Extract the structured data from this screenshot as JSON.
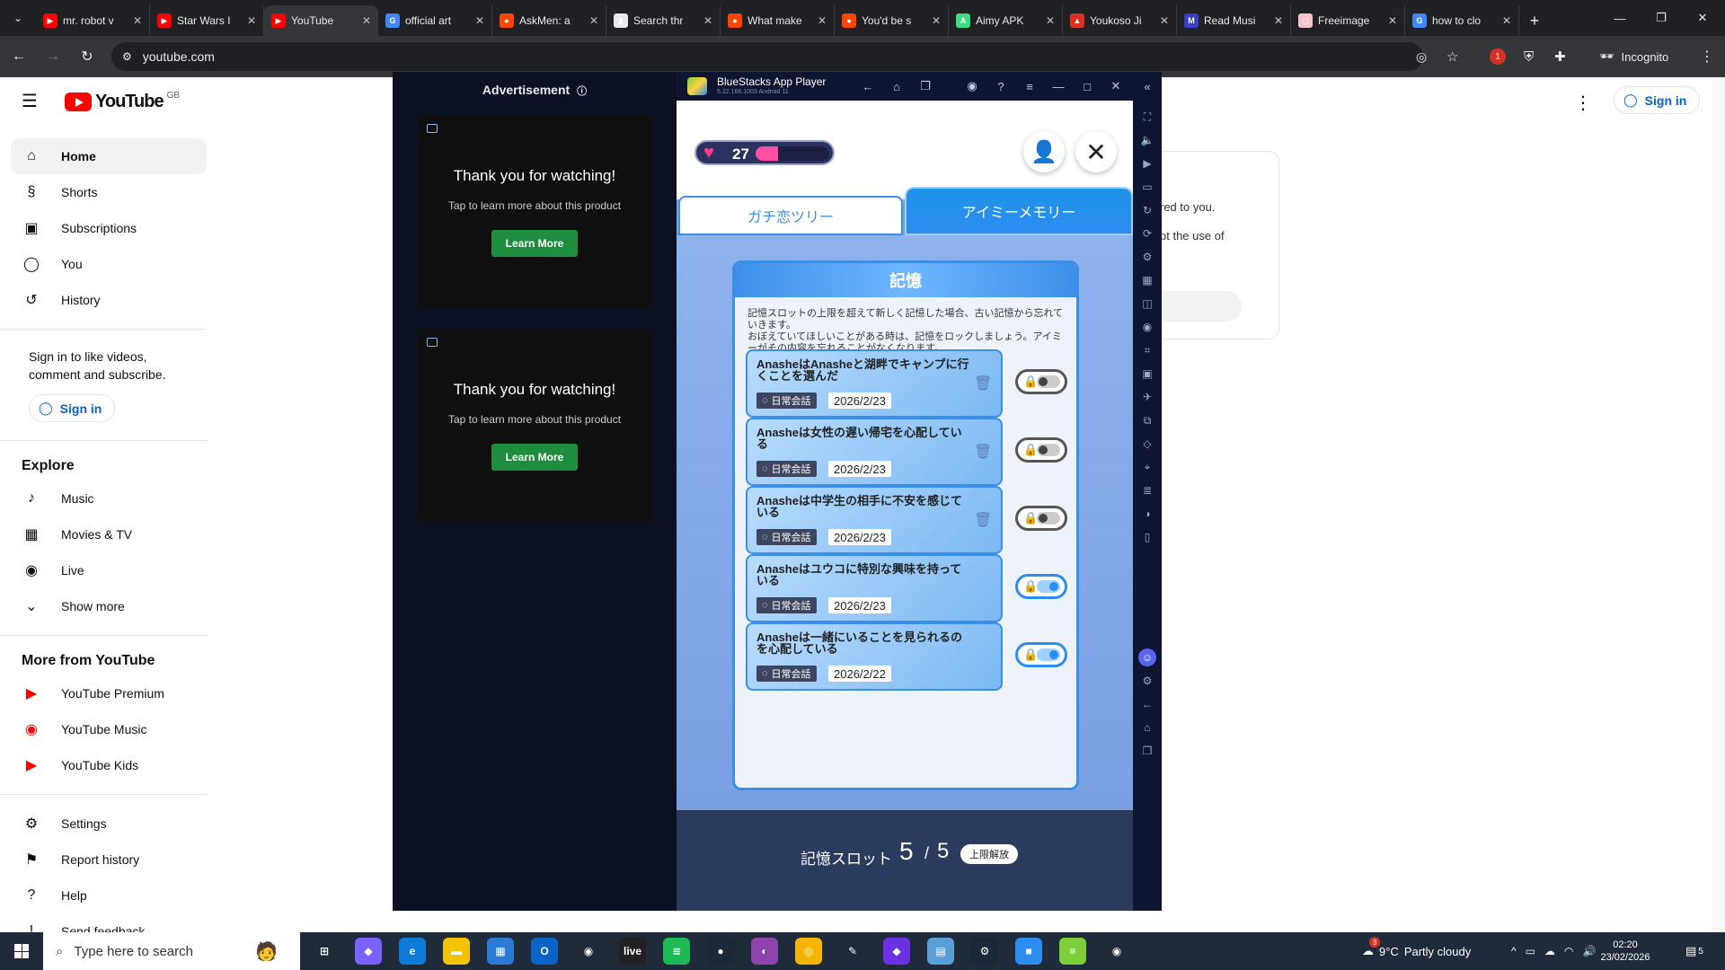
{
  "browser": {
    "tabs": [
      {
        "label": "mr. robot v",
        "icon": "youtube-icon",
        "color": "#ff0000"
      },
      {
        "label": "Star Wars I",
        "icon": "youtube-icon",
        "color": "#ff0000"
      },
      {
        "label": "YouTube",
        "icon": "youtube-icon",
        "color": "#ff0000",
        "active": true
      },
      {
        "label": "official art",
        "icon": "google-icon",
        "color": "#4285f4"
      },
      {
        "label": "AskMen: a",
        "icon": "reddit-icon",
        "color": "#ff4500"
      },
      {
        "label": "Search thr",
        "icon": "document-icon",
        "color": "#e8eaed"
      },
      {
        "label": "What make",
        "icon": "reddit-icon",
        "color": "#ff4500"
      },
      {
        "label": "You'd be s",
        "icon": "reddit-icon",
        "color": "#ff4500"
      },
      {
        "label": "Aimy APK",
        "icon": "apk-icon",
        "color": "#3ddc84"
      },
      {
        "label": "Youkoso Ji",
        "icon": "manga-icon",
        "color": "#d93025"
      },
      {
        "label": "Read Musi",
        "icon": "bookmark-icon",
        "color": "#3c40c6"
      },
      {
        "label": "Freeimage",
        "icon": "image-host-icon",
        "color": "#f8c3c8"
      },
      {
        "label": "how to clo",
        "icon": "google-icon",
        "color": "#4285f4"
      }
    ],
    "url": "youtube.com",
    "incognito_label": "Incognito",
    "extension_badge": "1"
  },
  "youtube": {
    "logo_text": "YouTube",
    "region": "GB",
    "nav_main": [
      {
        "label": "Home",
        "icon": "home-icon",
        "active": true
      },
      {
        "label": "Shorts",
        "icon": "shorts-icon"
      },
      {
        "label": "Subscriptions",
        "icon": "subscriptions-icon"
      },
      {
        "label": "You",
        "icon": "you-icon"
      },
      {
        "label": "History",
        "icon": "history-icon"
      }
    ],
    "signin_prompt": "Sign in to like videos, comment and subscribe.",
    "signin_label": "Sign in",
    "explore_heading": "Explore",
    "nav_explore": [
      {
        "label": "Music",
        "icon": "music-icon"
      },
      {
        "label": "Movies & TV",
        "icon": "movies-icon"
      },
      {
        "label": "Live",
        "icon": "live-icon"
      },
      {
        "label": "Show more",
        "icon": "chevron-down-icon"
      }
    ],
    "more_heading": "More from YouTube",
    "nav_more": [
      {
        "label": "YouTube Premium",
        "icon": "youtube-premium-icon"
      },
      {
        "label": "YouTube Music",
        "icon": "youtube-music-icon"
      },
      {
        "label": "YouTube Kids",
        "icon": "youtube-kids-icon"
      }
    ],
    "nav_footer": [
      {
        "label": "Settings",
        "icon": "gear-icon"
      },
      {
        "label": "Report history",
        "icon": "flag-icon"
      },
      {
        "label": "Help",
        "icon": "help-icon"
      },
      {
        "label": "Send feedback",
        "icon": "feedback-icon"
      }
    ],
    "top_signin": "Sign in",
    "bg_card_line1": "red to you.",
    "bg_card_line2": "pt the use of"
  },
  "ad": {
    "title": "Advertisement",
    "cards": [
      {
        "heading": "Thank you for watching!",
        "sub": "Tap to learn more about this product",
        "button": "Learn More"
      },
      {
        "heading": "Thank you for watching!",
        "sub": "Tap to learn more about this product",
        "button": "Learn More"
      }
    ]
  },
  "bluestacks": {
    "title": "BlueStacks App Player",
    "version": "5.22.166.1003  Android 11"
  },
  "game": {
    "hearts": "27",
    "heart_fill_fraction": 0.3,
    "tab_left": "ガチ恋ツリー",
    "tab_right": "アイミーメモリー",
    "panel_title": "記憶",
    "panel_desc1": "記憶スロットの上限を超えて新しく記憶した場合、古い記憶から忘れていきます。",
    "panel_desc2": "おぼえていてほしいことがある時は、記憶をロックしましょう。アイミーがその内容を忘れることがなくなります。",
    "memories": [
      {
        "text": "AnasheはAnasheと湖畔でキャンプに行くことを選んだ",
        "tag": "日常会話",
        "date": "2026/2/23",
        "locked": false
      },
      {
        "text": "Anasheは女性の遅い帰宅を心配している",
        "tag": "日常会話",
        "date": "2026/2/23",
        "locked": false
      },
      {
        "text": "Anasheは中学生の相手に不安を感じている",
        "tag": "日常会話",
        "date": "2026/2/23",
        "locked": false
      },
      {
        "text": "Anasheはユウコに特別な興味を持っている",
        "tag": "日常会話",
        "date": "2026/2/23",
        "locked": true
      },
      {
        "text": "Anasheは一緒にいることを見られるのを心配している",
        "tag": "日常会話",
        "date": "2026/2/22",
        "locked": true
      }
    ],
    "slot_label": "記憶スロット",
    "slot_used": "5",
    "slot_sep": "/",
    "slot_max": "5",
    "slot_button": "上限解放"
  },
  "taskbar": {
    "search_placeholder": "Type here to search",
    "weather_temp": "9°C",
    "weather_text": "Partly cloudy",
    "weather_badge": "3",
    "time": "02:20",
    "date": "23/02/2026",
    "notification_count": "5",
    "apps": [
      {
        "icon": "task-view-icon",
        "color": "#1f2a3a",
        "label": "⊞"
      },
      {
        "icon": "copilot-icon",
        "color": "#7b61ff",
        "label": "◆"
      },
      {
        "icon": "edge-icon",
        "color": "#0f7bd8",
        "label": "e"
      },
      {
        "icon": "file-explorer-icon",
        "color": "#f5c400",
        "label": "▬"
      },
      {
        "icon": "store-icon",
        "color": "#2b7bd6",
        "label": "▦"
      },
      {
        "icon": "outlook-icon",
        "color": "#0a64c8",
        "label": "O"
      },
      {
        "icon": "chrome-icon",
        "color": "#1f2a3a",
        "label": "◉"
      },
      {
        "icon": "live-app-icon",
        "color": "#222222",
        "label": "live"
      },
      {
        "icon": "spotify-icon",
        "color": "#1db954",
        "label": "≋"
      },
      {
        "icon": "steam-icon",
        "color": "#1b2838",
        "label": "●"
      },
      {
        "icon": "purple-app-icon",
        "color": "#8e44ad",
        "label": "◐"
      },
      {
        "icon": "chrome-canary-icon",
        "color": "#f4b400",
        "label": "◎"
      },
      {
        "icon": "feather-app-icon",
        "color": "#1f2a3a",
        "label": "✎"
      },
      {
        "icon": "obsidian-icon",
        "color": "#6c31e3",
        "label": "◆"
      },
      {
        "icon": "notepad-icon",
        "color": "#5aa0d8",
        "label": "▤"
      },
      {
        "icon": "steam-client-icon",
        "color": "#1b2838",
        "label": "⚙"
      },
      {
        "icon": "bluestacks-icon",
        "color": "#2d8cf0",
        "label": "■"
      },
      {
        "icon": "bluestacks-multi-icon",
        "color": "#7ccf3a",
        "label": "≡"
      },
      {
        "icon": "chrome-incognito-icon",
        "color": "#1f2a3a",
        "label": "◉"
      }
    ]
  }
}
